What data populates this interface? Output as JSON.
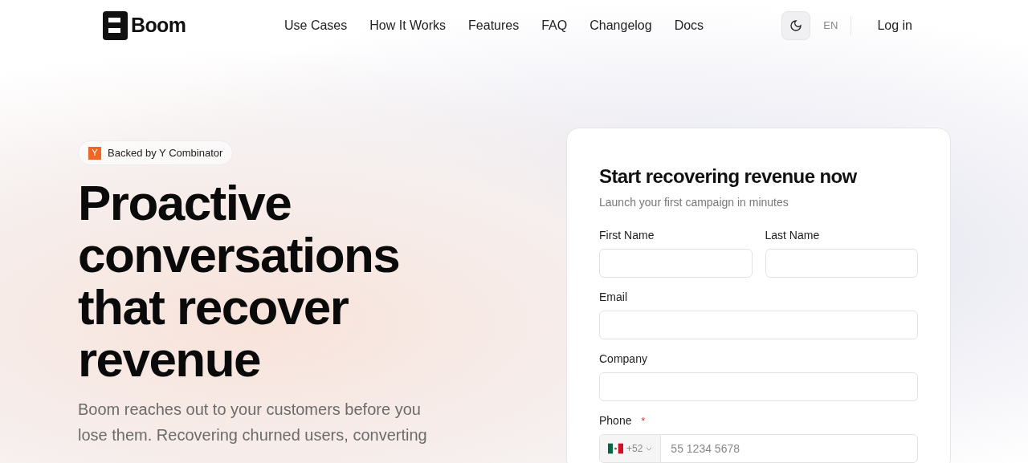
{
  "brand": {
    "name": "Boom"
  },
  "nav": {
    "links": [
      "Use Cases",
      "How It Works",
      "Features",
      "FAQ",
      "Changelog",
      "Docs"
    ],
    "language": "EN",
    "login": "Log in"
  },
  "hero": {
    "badge": {
      "mark": "Y",
      "text": "Backed by Y Combinator"
    },
    "headline": [
      "Proactive",
      "conversations",
      "that recover",
      "revenue"
    ],
    "description": "Boom reaches out to your customers before you lose them. Recovering churned users, converting"
  },
  "form": {
    "title": "Start recovering revenue now",
    "subtitle": "Launch your first campaign in minutes",
    "fields": [
      {
        "kind": "text",
        "label": "First Name"
      },
      {
        "kind": "text",
        "label": "Last Name"
      },
      {
        "kind": "text",
        "label": "Email"
      },
      {
        "kind": "text",
        "label": "Company"
      },
      {
        "kind": "phone",
        "label": "Phone",
        "required_mark": "*",
        "country_code": "+52",
        "placeholder": "55 1234 5678"
      }
    ]
  }
}
